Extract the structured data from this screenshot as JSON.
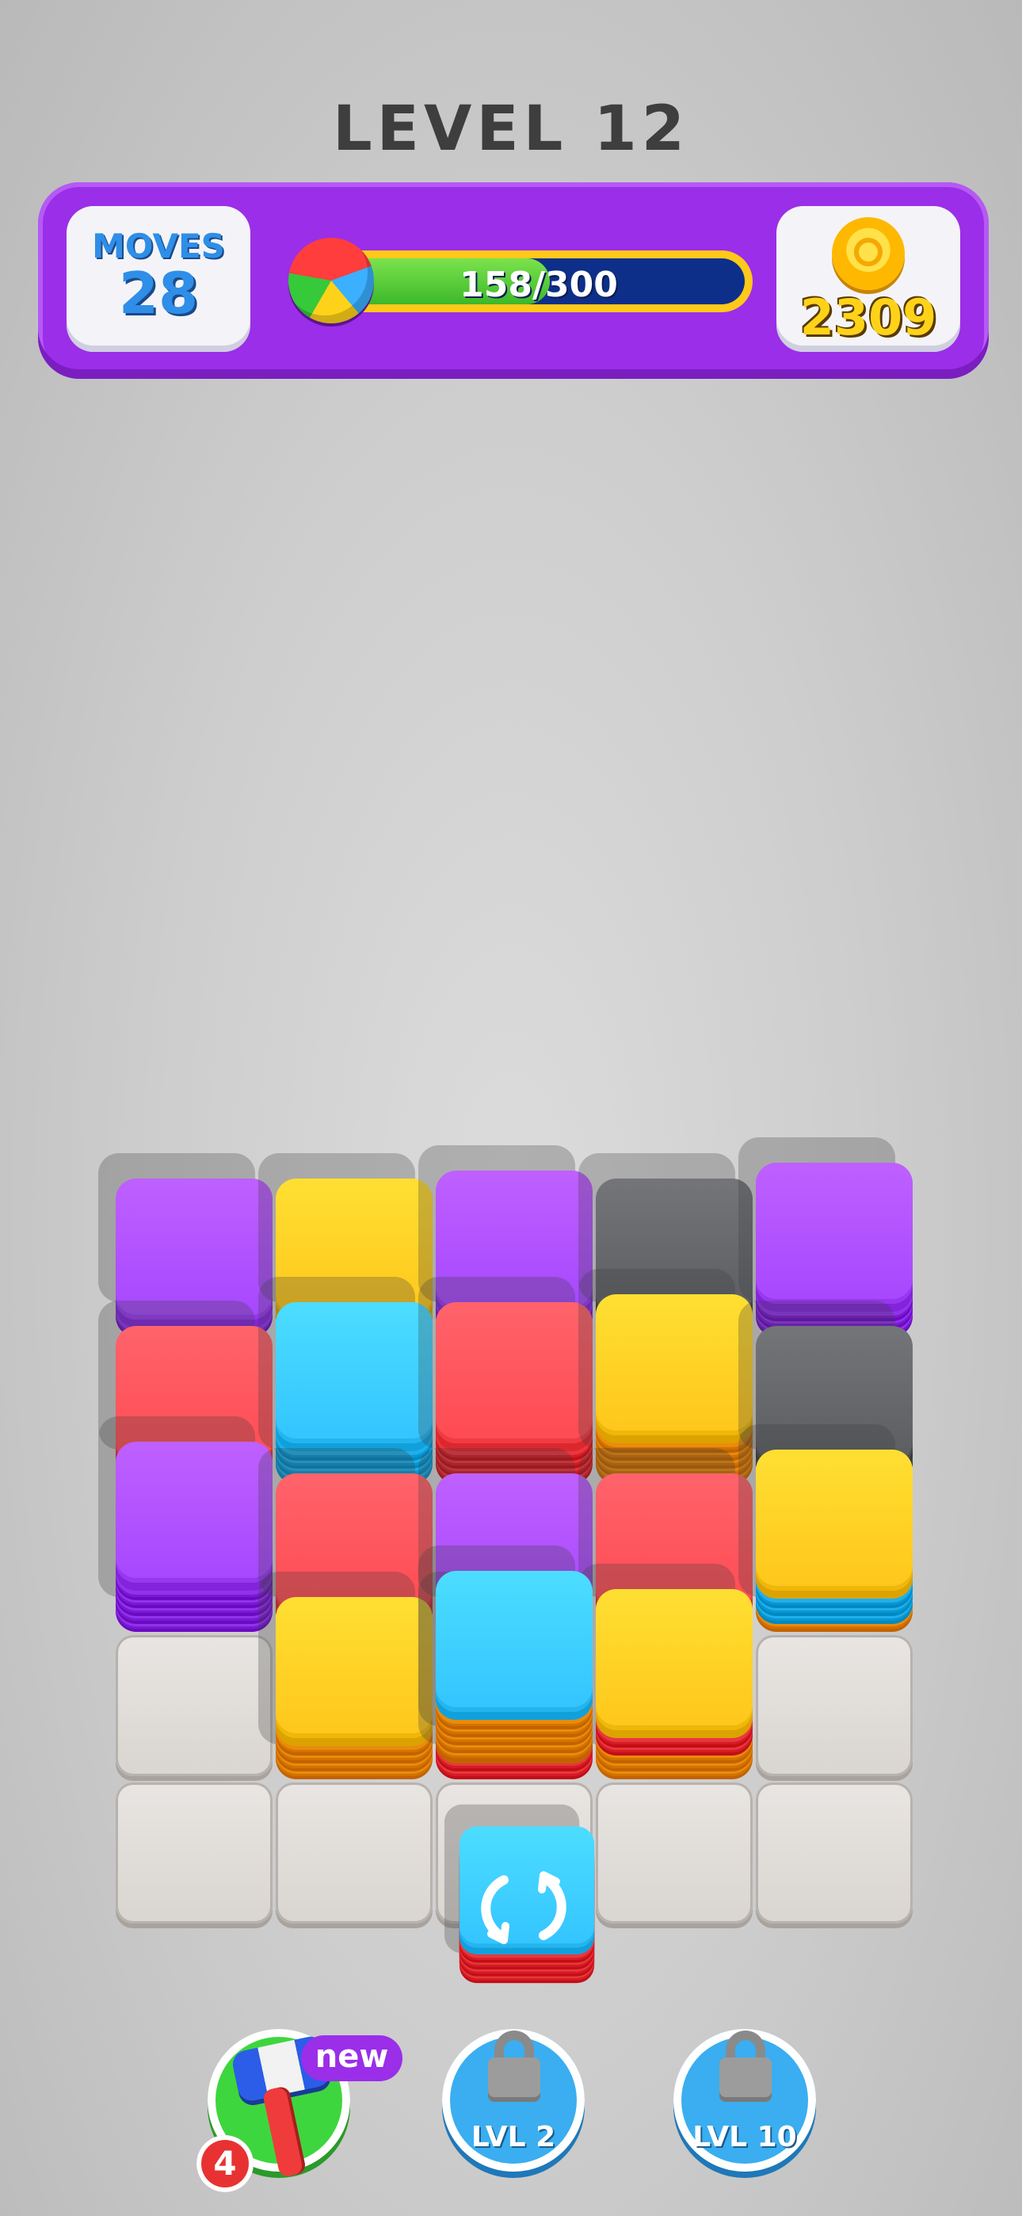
{
  "header": {
    "level_title": "LEVEL 12"
  },
  "stats": {
    "moves_label": "MOVES",
    "moves_value": "28",
    "progress_text": "158/300",
    "progress_fraction": 0.527,
    "coins_value": "2309"
  },
  "colors": {
    "purple": "#a647ff",
    "yellow": "#ffc61a",
    "blue": "#33c4ff",
    "red": "#ff4a52",
    "gray": "#5a5c60",
    "orange": "#ff9f1f",
    "empty_tile": "#e1ddd9",
    "accent_purple": "#9b2ee8"
  },
  "board": {
    "columns": 5,
    "rows": 5,
    "stacks": [
      {
        "col": 0,
        "row": 0,
        "top": "purple",
        "layers": [
          "purple"
        ]
      },
      {
        "col": 1,
        "row": 0,
        "top": "yellow",
        "layers": [
          "yellow"
        ]
      },
      {
        "col": 2,
        "row": 0,
        "top": "purple",
        "layers": [
          "purple",
          "purple"
        ]
      },
      {
        "col": 3,
        "row": 0,
        "top": "gray",
        "layers": [
          "gray"
        ]
      },
      {
        "col": 4,
        "row": 0,
        "top": "purple",
        "layers": [
          "purple",
          "purple",
          "purple"
        ]
      },
      {
        "col": 0,
        "row": 1,
        "top": "red",
        "layers": [
          "red"
        ]
      },
      {
        "col": 1,
        "row": 1,
        "top": "blue",
        "layers": [
          "blue",
          "blue",
          "blue",
          "blue"
        ]
      },
      {
        "col": 2,
        "row": 1,
        "top": "red",
        "layers": [
          "red",
          "red",
          "red",
          "red"
        ]
      },
      {
        "col": 3,
        "row": 1,
        "top": "yellow",
        "layers": [
          "orange",
          "orange",
          "orange",
          "orange",
          "orange"
        ]
      },
      {
        "col": 4,
        "row": 1,
        "top": "gray",
        "layers": [
          "gray"
        ]
      },
      {
        "col": 0,
        "row": 2,
        "top": "purple",
        "layers": [
          "purple",
          "purple",
          "purple",
          "purple",
          "purple"
        ]
      },
      {
        "col": 1,
        "row": 2,
        "top": "red",
        "layers": [
          "red"
        ]
      },
      {
        "col": 2,
        "row": 2,
        "top": "purple",
        "layers": [
          "purple"
        ]
      },
      {
        "col": 3,
        "row": 2,
        "top": "red",
        "layers": [
          "red"
        ]
      },
      {
        "col": 4,
        "row": 2,
        "top": "yellow",
        "layers": [
          "orange",
          "blue",
          "blue",
          "blue"
        ]
      },
      {
        "col": 1,
        "row": 3,
        "top": "yellow",
        "layers": [
          "orange",
          "orange",
          "orange",
          "orange"
        ]
      },
      {
        "col": 2,
        "row": 3,
        "top": "red",
        "layers": [
          "red",
          "red",
          "orange",
          "orange"
        ]
      },
      {
        "col": 3,
        "row": 3,
        "top": "yellow",
        "layers": [
          "orange",
          "orange",
          "orange",
          "red",
          "red"
        ]
      }
    ],
    "empty_cells": [
      {
        "col": 0,
        "row": 3
      },
      {
        "col": 4,
        "row": 3
      },
      {
        "col": 0,
        "row": 4
      },
      {
        "col": 1,
        "row": 4
      },
      {
        "col": 2,
        "row": 4
      },
      {
        "col": 3,
        "row": 4
      },
      {
        "col": 4,
        "row": 4
      }
    ]
  },
  "next_stack": {
    "top": "blue",
    "layers": [
      "orange",
      "orange",
      "orange",
      "orange",
      "orange"
    ]
  },
  "swap_stack": {
    "top": "blue",
    "layers": [
      "red",
      "red",
      "red",
      "red"
    ],
    "icon": "swap-arrows-icon"
  },
  "boosters": {
    "hammer": {
      "icon": "hammer-icon",
      "badge_new": "new",
      "count": "4"
    },
    "locked_1": {
      "icon": "lock-icon",
      "label": "LVL 2"
    },
    "locked_2": {
      "icon": "lock-icon",
      "label": "LVL 10"
    }
  }
}
